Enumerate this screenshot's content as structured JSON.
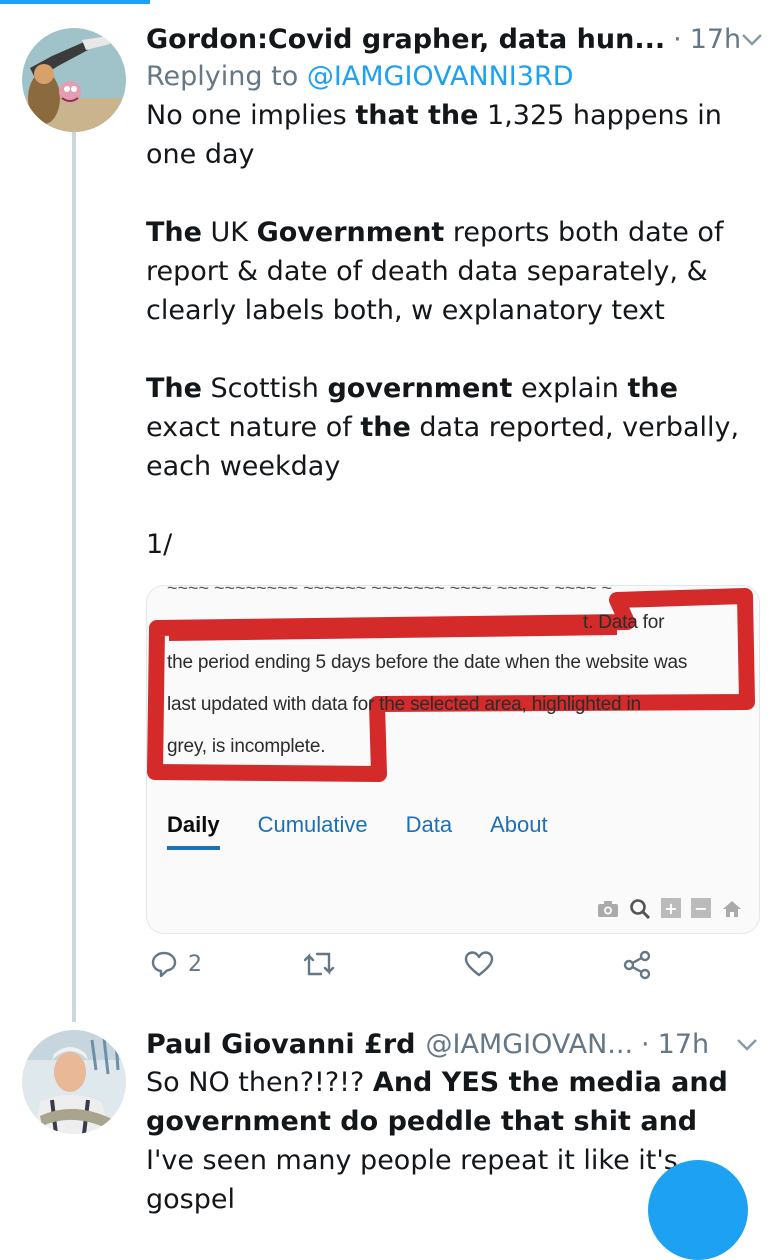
{
  "tweet1": {
    "display_name": "Gordon:Covid grapher, data hun...",
    "separator": "·",
    "time": "17h",
    "replying_prefix": "Replying to",
    "replying_handle": "@IAMGIOVANNI3RD",
    "line1_a": "No one implies ",
    "line1_b": "that the",
    "line1_c": " 1,325 happens in one day",
    "p2_a": "The",
    "p2_b": " UK ",
    "p2_c": "Government",
    "p2_d": " reports both date of report & date of death data separately, & clearly labels both, w explanatory text",
    "p3_a": "The",
    "p3_b": " Scottish ",
    "p3_c": "government",
    "p3_d": " explain ",
    "p3_e": "the",
    "p3_f": " exact nature of ",
    "p3_g": "the",
    "p3_h": " data reported, verbally, each weekday",
    "p4": "1/",
    "embedded": {
      "line1": "t. Data for",
      "line2": "the period ending 5 days before the date when the website was",
      "line3": "last updated with data for the selected area, highlighted in",
      "line4": "grey, is incomplete.",
      "tabs": [
        "Daily",
        "Cumulative",
        "Data",
        "About"
      ],
      "active_tab": "Daily",
      "highlight_color": "#d42a2a"
    },
    "actions": {
      "reply_count": "2",
      "retweet_count": "",
      "like_count": ""
    }
  },
  "tweet2": {
    "display_name": "Paul Giovanni £rd",
    "handle": "@IAMGIOVAN...",
    "separator": "·",
    "time": "17h",
    "text_a": "So NO then?!?!? ",
    "text_b": "And YES the media and government do peddle that shit and",
    "text_c": " I've seen many people repeat it like it's gospel"
  },
  "colors": {
    "accent": "#1da1f2",
    "secondary_text": "#657786",
    "thread_line": "#ccd6dd"
  },
  "icons": [
    "chevron-down-icon",
    "reply-icon",
    "retweet-icon",
    "like-icon",
    "share-icon",
    "camera-icon",
    "zoom-icon",
    "plus-icon",
    "minus-icon",
    "home-icon"
  ]
}
